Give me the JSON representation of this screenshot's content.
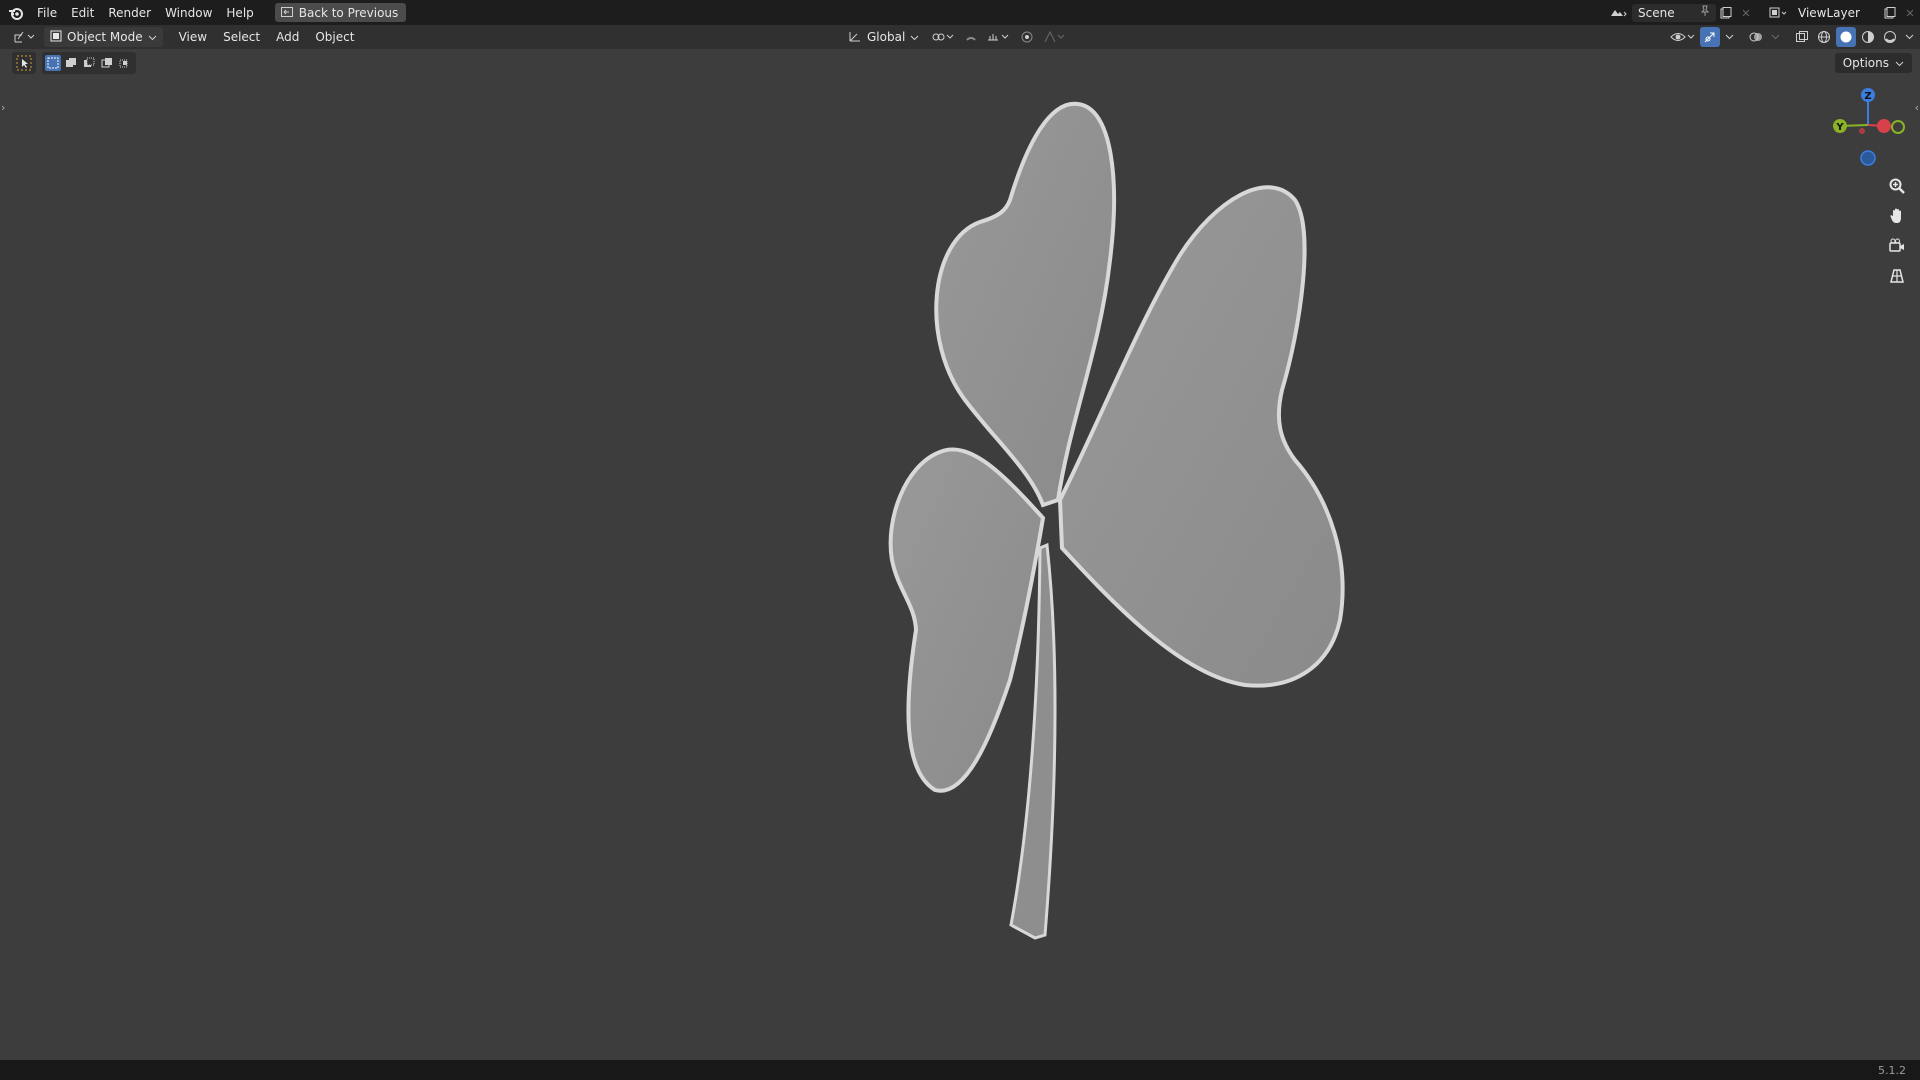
{
  "topbar": {
    "menus": [
      "File",
      "Edit",
      "Render",
      "Window",
      "Help"
    ],
    "back_button": "Back to Previous",
    "scene": "Scene",
    "view_layer": "ViewLayer"
  },
  "header": {
    "mode": "Object Mode",
    "menus": [
      "View",
      "Select",
      "Add",
      "Object"
    ],
    "transform_orientation": "Global",
    "options": "Options"
  },
  "gizmo": {
    "z": "Z",
    "y": "Y"
  },
  "status": {
    "version": "5.1.2"
  },
  "colors": {
    "viewport_bg": "#3d3d3d",
    "topbar_bg": "#1d1d1d",
    "header_bg": "#303030",
    "accent": "#4772b3",
    "axis_x": "#d8404a",
    "axis_y": "#8ab326",
    "axis_z": "#3a7ee0",
    "model": "#8f8f8f"
  }
}
